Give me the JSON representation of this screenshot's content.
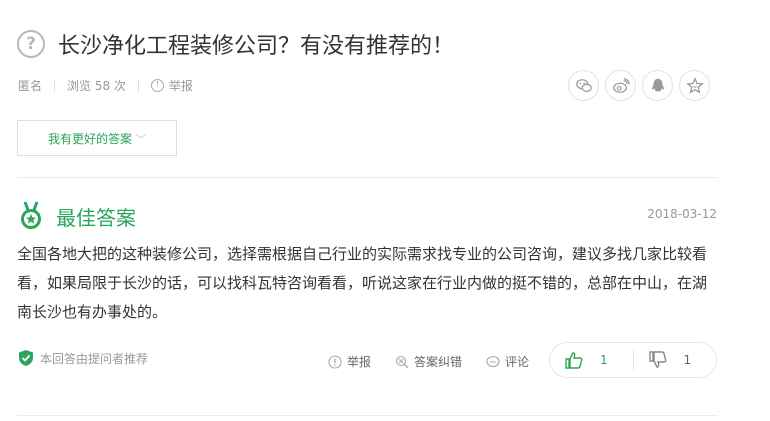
{
  "question": {
    "title": "长沙净化工程装修公司？有没有推荐的！",
    "icon": "question-circle-icon"
  },
  "meta": {
    "author": "匿名",
    "views": "浏览 58 次",
    "report": "举报"
  },
  "share": {
    "icons": [
      "wechat-icon",
      "weibo-icon",
      "qq-icon",
      "star-icon"
    ]
  },
  "better_answer_button": "我有更好的答案",
  "best_answer": {
    "label": "最佳答案",
    "date": "2018-03-12",
    "content": "全国各地大把的这种装修公司，选择需根据自己行业的实际需求找专业的公司咨询，建议多找几家比较看看，如果局限于长沙的话，可以找科瓦特咨询看看，听说这家在行业内做的挺不错的，总部在中山，在湖南长沙也有办事处的。",
    "recommended_note": "本回答由提问者推荐"
  },
  "actions": {
    "report": "举报",
    "correction": "答案纠错",
    "comment": "评论"
  },
  "votes": {
    "up": "1",
    "down": "1"
  },
  "colors": {
    "accent": "#2aa55a",
    "muted": "#999999"
  }
}
